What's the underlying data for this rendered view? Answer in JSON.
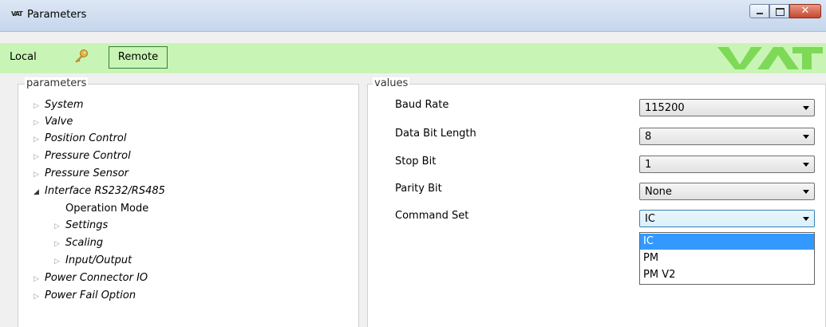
{
  "window": {
    "title": "Parameters",
    "logo_text": "VAT"
  },
  "toolbar": {
    "local_label": "Local",
    "remote_label": "Remote",
    "logo_text": "VAT"
  },
  "parameters": {
    "group_label": "parameters",
    "tree": [
      {
        "label": "System",
        "expanded": false
      },
      {
        "label": "Valve",
        "expanded": false
      },
      {
        "label": "Position Control",
        "expanded": false
      },
      {
        "label": "Pressure Control",
        "expanded": false
      },
      {
        "label": "Pressure Sensor",
        "expanded": false
      },
      {
        "label": "Interface RS232/RS485",
        "expanded": true
      },
      {
        "label": "Operation Mode",
        "expanded": null
      },
      {
        "label": "Settings",
        "expanded": false
      },
      {
        "label": "Scaling",
        "expanded": false
      },
      {
        "label": "Input/Output",
        "expanded": false
      },
      {
        "label": "Power Connector IO",
        "expanded": false
      },
      {
        "label": "Power Fail Option",
        "expanded": false
      }
    ]
  },
  "values": {
    "group_label": "values",
    "rows": [
      {
        "label": "Baud Rate",
        "value": "115200"
      },
      {
        "label": "Data Bit Length",
        "value": "8"
      },
      {
        "label": "Stop Bit",
        "value": "1"
      },
      {
        "label": "Parity Bit",
        "value": "None"
      },
      {
        "label": "Command Set",
        "value": "IC"
      }
    ],
    "dropdown_options": [
      "IC",
      "PM",
      "PM V2"
    ],
    "dropdown_selected": "IC"
  },
  "colors": {
    "toolbar_bg": "#c8f5b5",
    "selection": "#3399ff",
    "logo": "#7ed957"
  }
}
